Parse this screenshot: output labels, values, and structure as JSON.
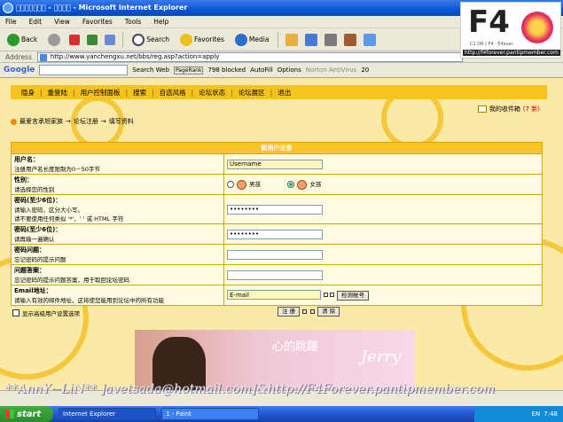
{
  "window": {
    "title": "\u0000\u0000\u0000\u0000\u0000\u0000\u0000 - \u0000\u0000\u0000\u0000 - Microsoft Internet Explorer"
  },
  "menu": [
    "File",
    "Edit",
    "View",
    "Favorites",
    "Tools",
    "Help"
  ],
  "toolbar": {
    "back": "Back",
    "search": "Search",
    "favorites": "Favorites",
    "media": "Media"
  },
  "address": {
    "label": "Address",
    "url": "http://www.yanchengxu.net/bbs/reg.asp?action=apply"
  },
  "google": {
    "logo": "Google",
    "search_web": "Search Web",
    "pagerank": "PageRank",
    "blocked": "798 blocked",
    "autofill": "AutoFill",
    "options": "Options",
    "antivirus": "Norton AntiVirus",
    "count": "20"
  },
  "logo": {
    "text": "F4",
    "sub": "C1 DR | F4 · E4ever",
    "url": "http://f4forever.pantipmember.com"
  },
  "nav": [
    "隐身",
    "重登陆",
    "用户控制面板",
    "搜索",
    "自选风格",
    "论坛状态",
    "论坛展区",
    "退出"
  ],
  "inbox": {
    "label": "我的收件箱",
    "count": "(7 新)"
  },
  "breadcrumb": [
    "最爱言承旭家族",
    "→",
    "论坛注册",
    "→",
    "填写资料"
  ],
  "form": {
    "header": "新用户注册",
    "username": {
      "label": "用户名：",
      "hint": "注册用户名长度限制为0－50字节",
      "value": "Username"
    },
    "gender": {
      "label": "性别：",
      "hint": "请选择您的性别",
      "male": "男孩",
      "female": "女孩"
    },
    "password": {
      "label": "密码(至少6位)：",
      "hint1": "请输入密码，区分大小写。",
      "hint2": "请不要使用任何类似 '*'、' ' 或 HTML 字符",
      "value": "••••••••"
    },
    "password2": {
      "label": "密码(至少6位)：",
      "hint": "请再输一遍确认",
      "value": "••••••••"
    },
    "question": {
      "label": "密码问题：",
      "hint": "忘记密码的提示问题"
    },
    "answer": {
      "label": "问题答案：",
      "hint": "忘记密码的提示问题答案，用于取回论坛密码"
    },
    "email": {
      "label": "Email地址：",
      "hint": "请输入有效的邮件地址，这将使您能用到论坛中的所有功能",
      "value": "E-mail",
      "check": "检测帐号"
    },
    "advanced": "显示高级用户设置选项",
    "submit": "注 册",
    "clear": "清 除"
  },
  "banner": {
    "text1": "心的跳躍",
    "text2": "Jerry"
  },
  "watermark": "**AnnY~LiN** ]avetsada@hotmail.com]&http://F4Forever.pantipmember.com",
  "taskbar": {
    "start": "start",
    "tasks": [
      "Internet Explorer",
      "1 - Paint"
    ],
    "lang": "EN",
    "clock": "7:48"
  }
}
